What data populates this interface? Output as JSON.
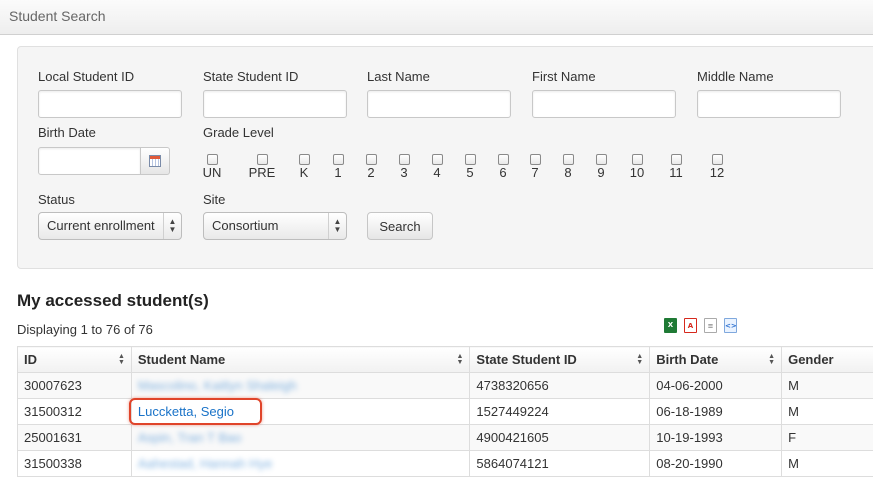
{
  "header": {
    "title": "Student Search"
  },
  "search_form": {
    "fields": {
      "local_student_id": {
        "label": "Local Student ID",
        "value": ""
      },
      "state_student_id": {
        "label": "State Student ID",
        "value": ""
      },
      "last_name": {
        "label": "Last Name",
        "value": ""
      },
      "first_name": {
        "label": "First Name",
        "value": ""
      },
      "middle_name": {
        "label": "Middle Name",
        "value": ""
      },
      "birth_date": {
        "label": "Birth Date",
        "value": ""
      }
    },
    "grade_level": {
      "label": "Grade Level",
      "options": [
        "UN",
        "PRE",
        "K",
        "1",
        "2",
        "3",
        "4",
        "5",
        "6",
        "7",
        "8",
        "9",
        "10",
        "11",
        "12"
      ]
    },
    "status": {
      "label": "Status",
      "selected": "Current enrollment"
    },
    "site": {
      "label": "Site",
      "selected": "Consortium"
    },
    "search_button": "Search"
  },
  "results": {
    "title": "My accessed student(s)",
    "summary": "Displaying 1 to 76 of 76",
    "export_icons": [
      "excel-icon",
      "pdf-icon",
      "text-document-icon",
      "xml-icon"
    ],
    "columns": [
      "ID",
      "Student Name",
      "State Student ID",
      "Birth Date",
      "Gender"
    ],
    "rows": [
      {
        "id": "30007623",
        "name": "Mascolino, Kaitlyn Shaleigh",
        "state_id": "4738320656",
        "birth_date": "04-06-2000",
        "gender": "M"
      },
      {
        "id": "31500312",
        "name": "Luccketta, Segio",
        "state_id": "1527449224",
        "birth_date": "06-18-1989",
        "gender": "M"
      },
      {
        "id": "25001631",
        "name": "Aspin, Tran T Bao",
        "state_id": "4900421605",
        "birth_date": "10-19-1993",
        "gender": "F"
      },
      {
        "id": "31500338",
        "name": "Aahestad, Hannah Hye",
        "state_id": "5864074121",
        "birth_date": "08-20-1990",
        "gender": "M"
      }
    ]
  },
  "colors": {
    "link": "#1a73c8",
    "highlight": "#e0442a"
  }
}
